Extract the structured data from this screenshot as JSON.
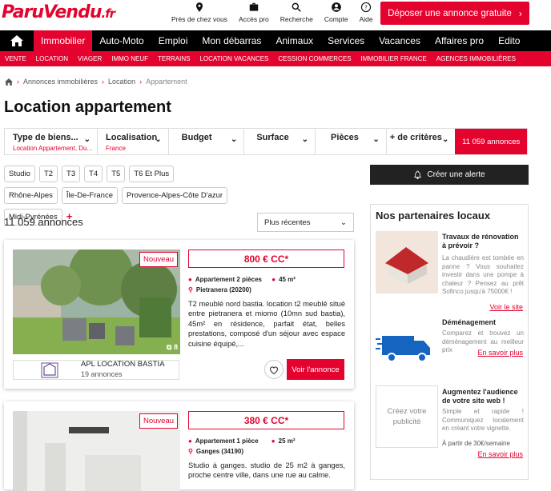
{
  "header": {
    "logo_main": "ParuVendu",
    "logo_tld": ".fr",
    "icons": [
      {
        "icon": "location-pin-icon",
        "label": "Près de chez vous"
      },
      {
        "icon": "briefcase-icon",
        "label": "Accès pro"
      },
      {
        "icon": "search-icon",
        "label": "Recherche"
      },
      {
        "icon": "user-icon",
        "label": "Compte"
      },
      {
        "icon": "help-icon",
        "label": "Aide"
      }
    ],
    "deposit_label": "Déposer une annonce gratuite"
  },
  "nav": {
    "items": [
      "Immobilier",
      "Auto-Moto",
      "Emploi",
      "Mon débarras",
      "Animaux",
      "Services",
      "Vacances",
      "Affaires pro",
      "Edito"
    ],
    "active": "Immobilier",
    "sub_items": [
      "VENTE",
      "LOCATION",
      "VIAGER",
      "IMMO NEUF",
      "TERRAINS",
      "LOCATION VACANCES",
      "CESSION COMMERCES",
      "IMMOBILIER FRANCE",
      "AGENCES IMMOBILIÈRES"
    ]
  },
  "breadcrumb": [
    "Annonces immobilières",
    "Location",
    "Appartement"
  ],
  "page_title": "Location appartement",
  "filters": [
    {
      "label": "Type de biens...",
      "sub": "Location Appartement, Du..."
    },
    {
      "label": "Localisation",
      "sub": "France"
    },
    {
      "label": "Budget",
      "sub": ""
    },
    {
      "label": "Surface",
      "sub": ""
    },
    {
      "label": "Pièces",
      "sub": ""
    },
    {
      "label": "+ de critères",
      "sub": ""
    }
  ],
  "filter_count": "11 059 annonces",
  "chips_rooms": [
    "Studio",
    "T2",
    "T3",
    "T4",
    "T5",
    "T6 Et Plus"
  ],
  "chips_regions": [
    "Rhône-Alpes",
    "Île-De-France",
    "Provence-Alpes-Côte D'azur",
    "Midi-Pyrénées"
  ],
  "chips_more": "+",
  "alert_label": "Créer une alerte",
  "result_count": "11 059 annonces",
  "sort_value": "Plus récentes",
  "listings": [
    {
      "badge": "Nouveau",
      "price": "800 € CC*",
      "rooms": "Appartement 2 pièces",
      "surface": "45 m²",
      "location": "Pietranera (20200)",
      "description": "T2 meublé nord bastia. location t2 meublé situé entre pietranera et miomo (10mn sud bastia), 45m² en résidence, parfait état, belles prestations, composé d'un séjour avec espace cuisine équipé,...",
      "photo_count": "8",
      "agency": "APL LOCATION BASTIA",
      "agency_count": "19 annonces",
      "cta": "Voir l'annonce"
    },
    {
      "badge": "Nouveau",
      "price": "380 € CC*",
      "rooms": "Appartement 1 pièce",
      "surface": "25 m²",
      "location": "Ganges (34190)",
      "description": "Studio à ganges. studio de 25 m2 à ganges, proche centre ville, dans une rue au calme."
    }
  ],
  "partners": {
    "title": "Nos partenaires locaux",
    "items": [
      {
        "title": "Travaux de rénovation à prévoir ?",
        "text": "La chaudière est tombée en panne ? Vous souhaitez investir dans une pompe à chaleur ? Pensez au prêt Sofinco jusqu'à 75000€ !",
        "link": "Voir le site"
      },
      {
        "title": "Déménagement",
        "text": "Comparez et trouvez un déménagement au meilleur prix",
        "link": "En savoir plus"
      },
      {
        "title": "Augmentez l'audience de votre site web !",
        "text": "Simple et rapide ! Communiquez localement en créant votre vignette.",
        "extra": "À partir de 30€/semaine",
        "link": "En savoir plus"
      }
    ],
    "pub_label": "Créez votre publicité"
  },
  "colors": {
    "brand": "#e4032e",
    "nav_bg": "#000000"
  }
}
